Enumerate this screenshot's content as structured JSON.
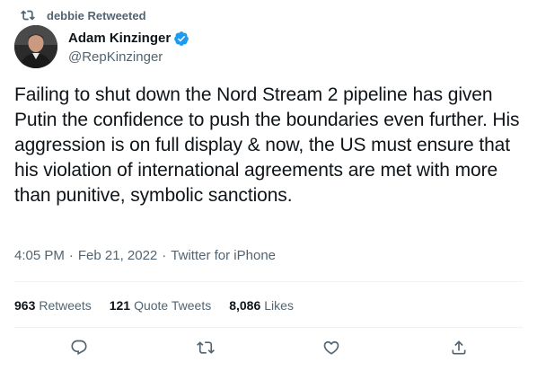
{
  "retweet_context": {
    "icon": "retweet-icon",
    "label": "debbie Retweeted"
  },
  "author": {
    "display_name": "Adam Kinzinger",
    "handle": "@RepKinzinger",
    "verified": true,
    "verified_color": "#1d9bf0",
    "avatar": "avatar-photo"
  },
  "tweet": {
    "text": "Failing to shut down the Nord Stream 2 pipeline has given Putin the confidence to push the boundaries even further. His aggression is on full display & now, the US must ensure that his violation of international agreements are met with more than punitive, symbolic sanctions."
  },
  "meta": {
    "time": "4:05 PM",
    "separator": "·",
    "date": "Feb 21, 2022",
    "source": "Twitter for iPhone"
  },
  "stats": {
    "retweets": {
      "count": "963",
      "label": "Retweets"
    },
    "quote_tweets": {
      "count": "121",
      "label": "Quote Tweets"
    },
    "likes": {
      "count": "8,086",
      "label": "Likes"
    }
  },
  "actions": [
    {
      "name": "reply",
      "icon": "reply-icon"
    },
    {
      "name": "retweet",
      "icon": "retweet-icon"
    },
    {
      "name": "like",
      "icon": "heart-icon"
    },
    {
      "name": "share",
      "icon": "share-icon"
    }
  ],
  "colors": {
    "text_primary": "#0f1419",
    "text_secondary": "#536471",
    "divider": "#eff3f4",
    "verified": "#1d9bf0"
  }
}
